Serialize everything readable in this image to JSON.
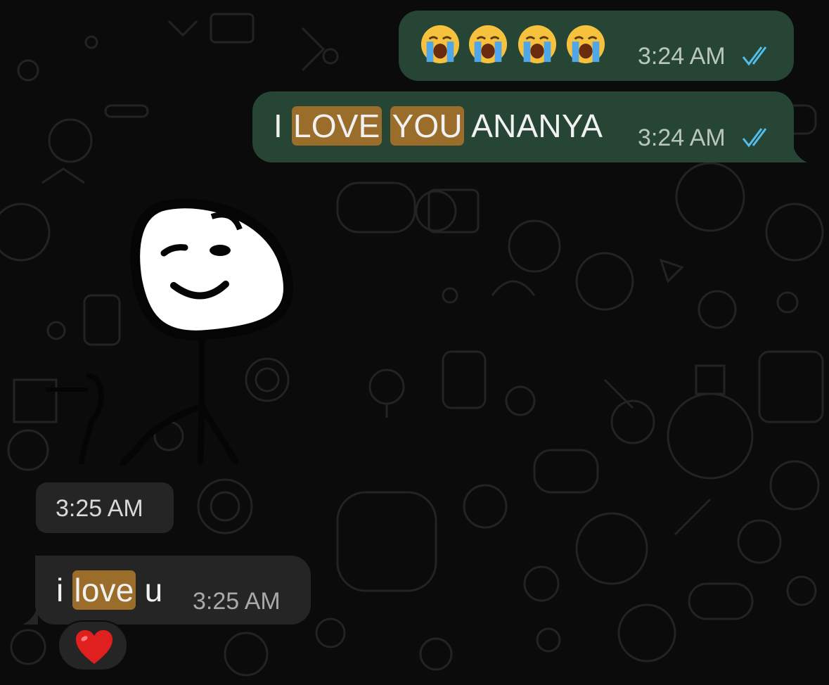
{
  "chat": {
    "messages": [
      {
        "direction": "outgoing",
        "kind": "emoji",
        "emoji_icons": [
          "loudly-crying-face-icon",
          "loudly-crying-face-icon",
          "loudly-crying-face-icon",
          "loudly-crying-face-icon"
        ],
        "time": "3:24 AM",
        "status_icon": "double-check-read-icon"
      },
      {
        "direction": "outgoing",
        "kind": "text",
        "text_parts": [
          "I ",
          "LOVE",
          " ",
          "YOU",
          " ANANYA"
        ],
        "highlighted_words": [
          "LOVE",
          "YOU"
        ],
        "time": "3:24 AM",
        "status_icon": "double-check-read-icon"
      },
      {
        "direction": "incoming",
        "kind": "sticker",
        "sticker_icon": "winking-stick-figure-sticker",
        "time": "3:25 AM"
      },
      {
        "direction": "incoming",
        "kind": "text",
        "text_parts": [
          "i ",
          "love",
          " u"
        ],
        "highlighted_words": [
          "love"
        ],
        "time": "3:25 AM",
        "reaction": "red-heart-icon"
      }
    ]
  },
  "colors": {
    "background": "#0b0b0b",
    "outgoing_bubble": "#264535",
    "incoming_bubble": "#252525",
    "search_highlight": "#9a6d2b",
    "read_tick": "#53bdeb",
    "heart": "#e0201e"
  }
}
